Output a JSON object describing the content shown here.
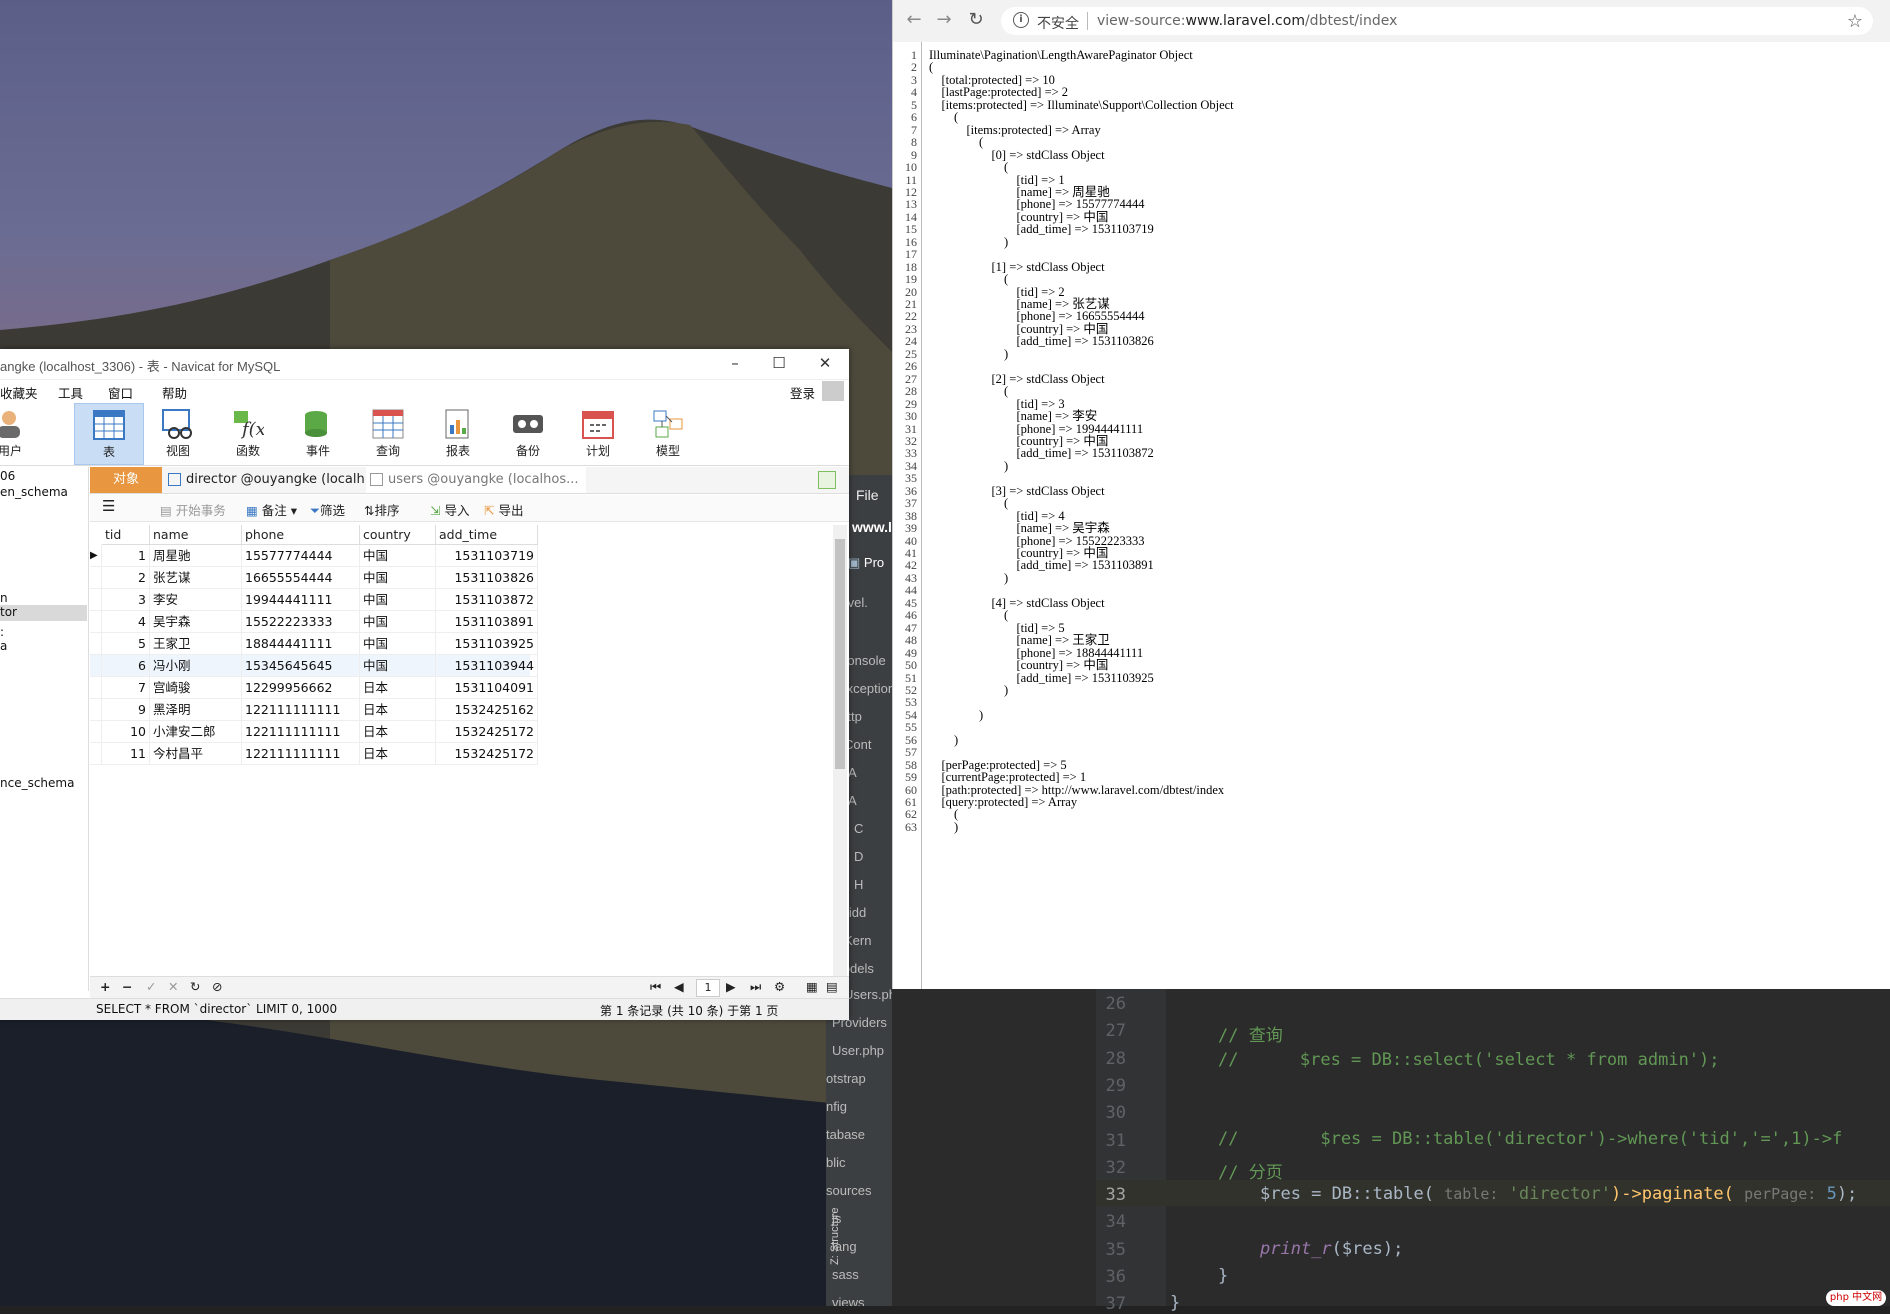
{
  "browser": {
    "insecure_label": "不安全",
    "url_prefix": "view-source:",
    "url_host": "www.laravel.com",
    "url_path": "/dbtest/index",
    "source_lines": [
      "Illuminate\\Pagination\\LengthAwarePaginator Object",
      "(",
      "    [total:protected] => 10",
      "    [lastPage:protected] => 2",
      "    [items:protected] => Illuminate\\Support\\Collection Object",
      "        (",
      "            [items:protected] => Array",
      "                (",
      "                    [0] => stdClass Object",
      "                        (",
      "                            [tid] => 1",
      "                            [name] => 周星驰",
      "                            [phone] => 15577774444",
      "                            [country] => 中国",
      "                            [add_time] => 1531103719",
      "                        )",
      "",
      "                    [1] => stdClass Object",
      "                        (",
      "                            [tid] => 2",
      "                            [name] => 张艺谋",
      "                            [phone] => 16655554444",
      "                            [country] => 中国",
      "                            [add_time] => 1531103826",
      "                        )",
      "",
      "                    [2] => stdClass Object",
      "                        (",
      "                            [tid] => 3",
      "                            [name] => 李安",
      "                            [phone] => 19944441111",
      "                            [country] => 中国",
      "                            [add_time] => 1531103872",
      "                        )",
      "",
      "                    [3] => stdClass Object",
      "                        (",
      "                            [tid] => 4",
      "                            [name] => 吴宇森",
      "                            [phone] => 15522223333",
      "                            [country] => 中国",
      "                            [add_time] => 1531103891",
      "                        )",
      "",
      "                    [4] => stdClass Object",
      "                        (",
      "                            [tid] => 5",
      "                            [name] => 王家卫",
      "                            [phone] => 18844441111",
      "                            [country] => 中国",
      "                            [add_time] => 1531103925",
      "                        )",
      "",
      "                )",
      "",
      "        )",
      "",
      "    [perPage:protected] => 5",
      "    [currentPage:protected] => 1",
      "    [path:protected] => http://www.laravel.com/dbtest/index",
      "    [query:protected] => Array",
      "        (",
      "        )"
    ]
  },
  "navicat": {
    "title": "angke (localhost_3306) - 表 - Navicat for MySQL",
    "menu": [
      "收藏夹",
      "工具",
      "窗口",
      "帮助"
    ],
    "login": "登录",
    "toolbar": [
      "用户",
      "表",
      "视图",
      "函数",
      "事件",
      "查询",
      "报表",
      "备份",
      "计划",
      "模型"
    ],
    "tab_object": "对象",
    "tab_director": "director @ouyangke (localh...",
    "tab_users": "users @ouyangke (localhos...",
    "sidebar": [
      "06",
      "en_schema",
      "n",
      "tor",
      ":",
      "a",
      "nce_schema"
    ],
    "grid_tools": {
      "begin": "开始事务",
      "note": "备注",
      "filter": "筛选",
      "sort": "排序",
      "import": "导入",
      "export": "导出"
    },
    "columns": [
      "tid",
      "name",
      "phone",
      "country",
      "add_time"
    ],
    "rows": [
      [
        "1",
        "周星驰",
        "15577774444",
        "中国",
        "1531103719"
      ],
      [
        "2",
        "张艺谋",
        "16655554444",
        "中国",
        "1531103826"
      ],
      [
        "3",
        "李安",
        "19944441111",
        "中国",
        "1531103872"
      ],
      [
        "4",
        "吴宇森",
        "15522223333",
        "中国",
        "1531103891"
      ],
      [
        "5",
        "王家卫",
        "18844441111",
        "中国",
        "1531103925"
      ],
      [
        "6",
        "冯小刚",
        "15345645645",
        "中国",
        "1531103944"
      ],
      [
        "7",
        "宫崎骏",
        "12299956662",
        "日本",
        "1531104091"
      ],
      [
        "9",
        "黑泽明",
        "122111111111",
        "日本",
        "1532425162"
      ],
      [
        "10",
        "小津安二郎",
        "122111111111",
        "日本",
        "1532425172"
      ],
      [
        "11",
        "今村昌平",
        "122111111111",
        "日本",
        "1532425172"
      ]
    ],
    "page_number": "1",
    "status_sql": "SELECT * FROM `director` LIMIT 0, 1000",
    "status_records": "第 1 条记录 (共 10 条) 于第 1 页"
  },
  "ide": {
    "menu_file": "File",
    "project_www": "www.l",
    "project_tab": "Pro",
    "tree": [
      "laravel.",
      "p",
      "Console",
      "Exception",
      "Http",
      "Cont",
      "A",
      "A",
      "C",
      "D",
      "H",
      "Midd",
      "Kern",
      "Models",
      "Users.php",
      "Providers",
      "User.php",
      "otstrap",
      "nfig",
      "tabase",
      "blic",
      "sources",
      "js",
      "lang",
      "sass",
      "views"
    ],
    "structure_tab": "Z: Structure",
    "line_numbers": [
      "26",
      "27",
      "28",
      "29",
      "30",
      "31",
      "32",
      "33",
      "34",
      "35",
      "36",
      "37"
    ],
    "comment_query": "// 查询",
    "line28": "//      $res = DB::select('select * from admin');",
    "line31": "//        $res = DB::table('director')->where('tid','=',1)->f",
    "comment_page": "// 分页",
    "line33_a": "$res = DB::table( ",
    "line33_hint1": "table:",
    "line33_str": " 'director'",
    "line33_b": ")->paginate( ",
    "line33_hint2": "perPage:",
    "line33_num": " 5",
    "line33_c": ");",
    "line35_fn": "print_r",
    "line35_rest": "($res);",
    "line36": "}",
    "line37": "}",
    "watermark": "php 中文网"
  }
}
